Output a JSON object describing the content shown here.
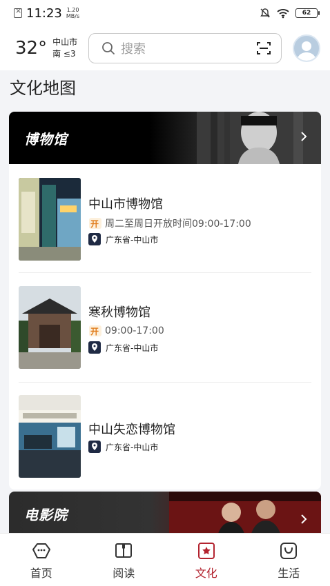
{
  "status_bar": {
    "time": "11:23",
    "net_speed_value": "1.20",
    "net_speed_unit": "MB/s",
    "battery": "62"
  },
  "header": {
    "temperature": "32°",
    "city": "中山市",
    "wind": "南  ≤3",
    "search_placeholder": "搜索"
  },
  "page_title": "文化地图",
  "museum_section": {
    "title": "博物馆",
    "venues": [
      {
        "name": "中山市博物馆",
        "hours": "周二至周日开放时间09:00-17:00",
        "location": "广东省-中山市"
      },
      {
        "name": "寒秋博物馆",
        "hours": "09:00-17:00",
        "location": "广东省-中山市"
      },
      {
        "name": "中山失恋博物馆",
        "location": "广东省-中山市"
      }
    ]
  },
  "cinema_section": {
    "title": "电影院"
  },
  "tabbar": {
    "tabs": [
      {
        "label": "首页",
        "icon": "home-chat-icon"
      },
      {
        "label": "阅读",
        "icon": "book-icon"
      },
      {
        "label": "文化",
        "icon": "culture-star-icon"
      },
      {
        "label": "生活",
        "icon": "life-bag-icon"
      }
    ],
    "active_color": "#b3232f"
  }
}
